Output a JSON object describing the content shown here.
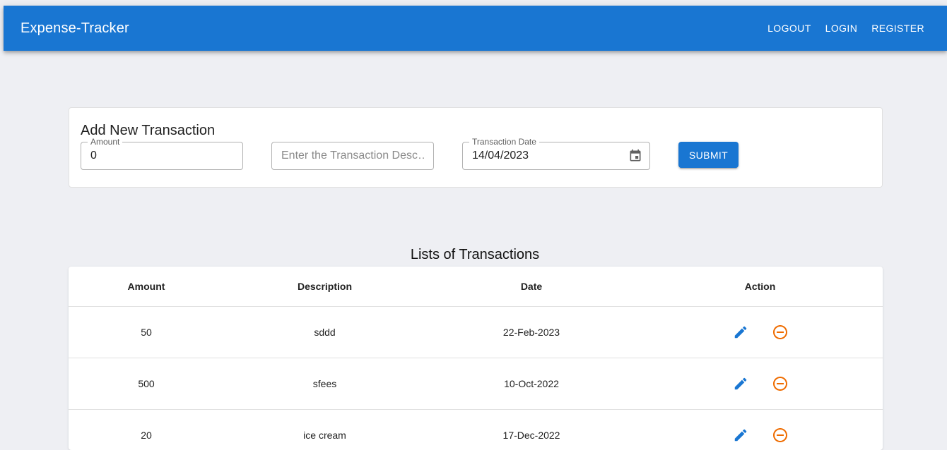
{
  "app": {
    "title": "Expense-Tracker",
    "nav": [
      {
        "label": "LOGOUT"
      },
      {
        "label": "LOGIN"
      },
      {
        "label": "REGISTER"
      }
    ]
  },
  "form": {
    "title": "Add New Transaction",
    "amount": {
      "label": "Amount",
      "value": "0"
    },
    "description": {
      "placeholder": "Enter the Transaction Desc…",
      "value": ""
    },
    "date": {
      "label": "Transaction Date",
      "value": "14/04/2023",
      "icon": "calendar-icon"
    },
    "submit_label": "SUBMIT"
  },
  "transactions": {
    "title": "Lists of Transactions",
    "columns": [
      "Amount",
      "Description",
      "Date",
      "Action"
    ],
    "rows": [
      {
        "amount": "50",
        "description": "sddd",
        "date": "22-Feb-2023"
      },
      {
        "amount": "500",
        "description": "sfees",
        "date": "10-Oct-2022"
      },
      {
        "amount": "20",
        "description": "ice cream",
        "date": "17-Dec-2022"
      }
    ],
    "icons": {
      "edit": "pencil-icon",
      "delete": "minus-circle-icon"
    }
  },
  "colors": {
    "primary": "#1976d2",
    "delete": "#ef6c00",
    "background": "#eeeff3"
  }
}
